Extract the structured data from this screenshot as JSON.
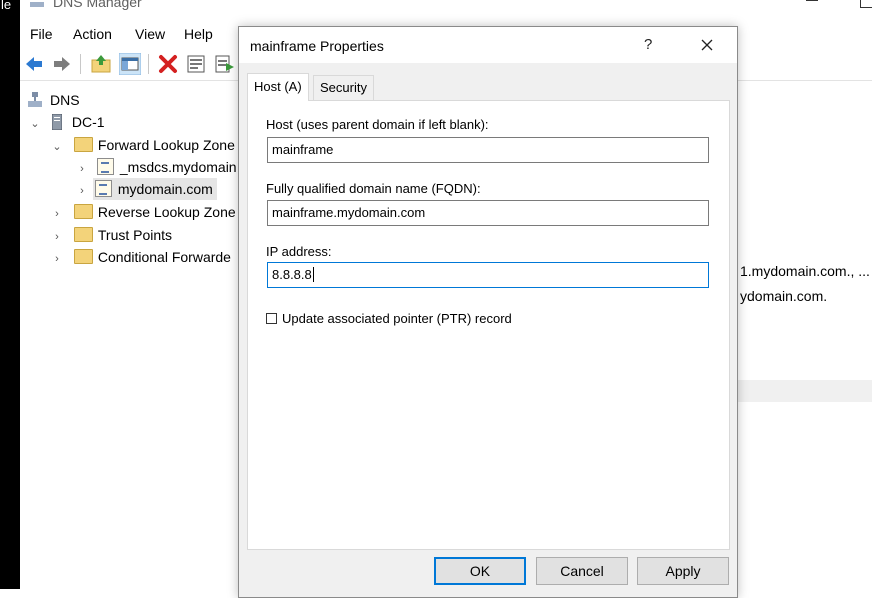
{
  "desktop": {
    "edge_text": "le"
  },
  "main_window": {
    "title": "DNS Manager",
    "menu": [
      "File",
      "Action",
      "View",
      "Help"
    ],
    "toolbar_icons": [
      "back-arrow-icon",
      "forward-arrow-icon",
      "up-folder-icon",
      "show-hide-console-tree-icon",
      "delete-icon",
      "properties-icon",
      "export-list-icon"
    ],
    "tree": {
      "root": "DNS",
      "server": "DC-1",
      "forward": "Forward Lookup Zone",
      "msdcs": "_msdcs.mydomain",
      "mydomain": "mydomain.com",
      "reverse": "Reverse Lookup Zone",
      "trust": "Trust Points",
      "conditional": "Conditional Forwarde"
    },
    "right_pane": {
      "line1": "1.mydomain.com., ...",
      "line2": "ydomain.com."
    }
  },
  "dialog": {
    "title": "mainframe Properties",
    "help": "?",
    "tabs": [
      "Host (A)",
      "Security"
    ],
    "active_tab": "Host (A)",
    "host_label": "Host (uses parent domain if left blank):",
    "host_value": "mainframe",
    "fqdn_label": "Fully qualified domain name (FQDN):",
    "fqdn_value": "mainframe.mydomain.com",
    "ip_label": "IP address:",
    "ip_value": "8.8.8.8",
    "ptr_label": "Update associated pointer (PTR) record",
    "ptr_checked": false,
    "buttons": {
      "ok": "OK",
      "cancel": "Cancel",
      "apply": "Apply"
    }
  },
  "colors": {
    "accent": "#0078d7",
    "dialog_bg": "#f0f0f0",
    "button_bg": "#e1e1e1"
  }
}
